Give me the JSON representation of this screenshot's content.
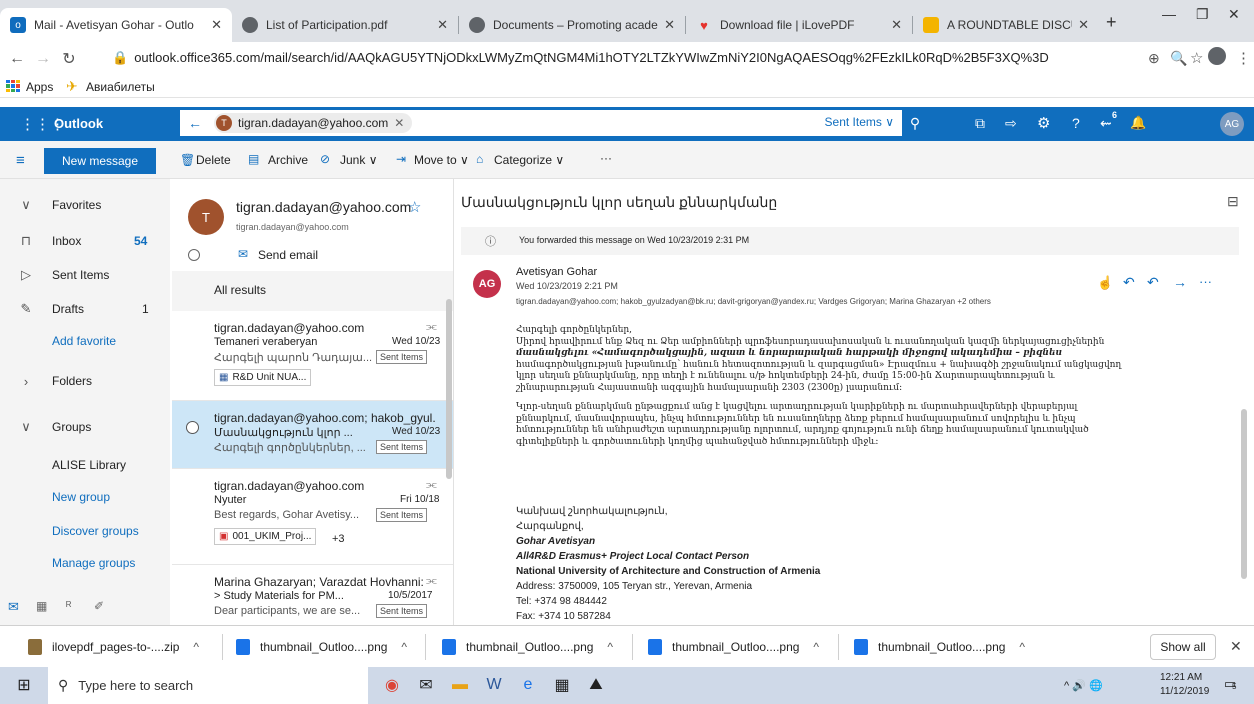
{
  "browser": {
    "tabs": [
      {
        "title": "Mail - Avetisyan Gohar - Outlo"
      },
      {
        "title": "List of Participation.pdf"
      },
      {
        "title": "Documents – Promoting acade"
      },
      {
        "title": "Download file | iLovePDF"
      },
      {
        "title": "A ROUNDTABLE DISCUSSION"
      }
    ],
    "new_tab": "+",
    "url": "outlook.office365.com/mail/search/id/AAQkAGU5YTNjODkxLWMyZmQtNGM4Mi1hOTY2LTZkYWIwZmNiY2I0NgAQAESOqg%2FEzkILk0RqD%2B5F3XQ%3D",
    "bookmarks": [
      "Apps",
      "Авиабилеты"
    ]
  },
  "outlook": {
    "app_name": "Outlook",
    "search_chip": "tigran.dadayan@yahoo.com",
    "search_scope": "Sent Items",
    "notif_count": "6",
    "avatar": "AG"
  },
  "commands": {
    "new_message": "New message",
    "delete": "Delete",
    "archive": "Archive",
    "junk": "Junk",
    "move_to": "Move to",
    "categorize": "Categorize",
    "more": "···"
  },
  "nav": {
    "favorites": "Favorites",
    "inbox": "Inbox",
    "inbox_count": "54",
    "sent": "Sent Items",
    "drafts": "Drafts",
    "drafts_count": "1",
    "add_favorite": "Add favorite",
    "folders": "Folders",
    "groups": "Groups",
    "alise": "ALISE Library",
    "new_group": "New group",
    "discover": "Discover groups",
    "manage": "Manage groups"
  },
  "contact": {
    "initial": "T",
    "name": "tigran.dadayan@yahoo.com",
    "email": "tigran.dadayan@yahoo.com",
    "send_email": "Send email",
    "all_results": "All results"
  },
  "messages": [
    {
      "from": "tigran.dadayan@yahoo.com",
      "subject": "Temaneri veraberyan",
      "date": "Wed 10/23",
      "preview": "Հարգելի պարոն Դադայա...",
      "folder": "Sent Items",
      "attachment": "R&D Unit NUA..."
    },
    {
      "from": "tigran.dadayan@yahoo.com; hakob_gyul.",
      "subject": "Մասնակցություն կլոր ...",
      "date": "Wed 10/23",
      "preview": "Հարգելի գործընկերներ, ...",
      "folder": "Sent Items"
    },
    {
      "from": "tigran.dadayan@yahoo.com",
      "subject": "Nyuter",
      "date": "Fri 10/18",
      "preview": "Best regards, Gohar Avetisy...",
      "folder": "Sent Items",
      "attachment": "001_UKIM_Proj...",
      "extra": "+3"
    },
    {
      "from": "Marina Ghazaryan; Varazdat Hovhanni:",
      "subject": "> Study Materials for PM...",
      "date": "10/5/2017",
      "preview": "Dear participants, we are se...",
      "folder": "Sent Items"
    }
  ],
  "reading": {
    "subject": "Մասնակցություն կլոր սեղան քննարկմանը",
    "forwarded_note": "You forwarded this message on Wed 10/23/2019 2:31 PM",
    "sender_initials": "AG",
    "sender": "Avetisyan Gohar",
    "sent_date": "Wed 10/23/2019 2:21 PM",
    "recipients": "tigran.dadayan@yahoo.com; hakob_gyulzadyan@bk.ru; davit-grigoryan@yandex.ru; Vardges Grigoryan; Marina Ghazaryan +2 others",
    "greeting": "Հարգելի գործընկերներ,",
    "p1_lines": [
      "Սիրով հրավիրում ենք Ձեզ ու Ձեր ամբիոնների պրոֆեսորադասախոսական և ուսանողական կազմի ներկայացուցիչներին",
      "մասնակցելու «Համագործակցային, ազատ և նորարարական հարթակի միջոցով ակադեմիա – բիզնես",
      "համագործակցության խթանումը՝ հանուն հետազոտության և զարգացման» Էրազմուս + նախագծի շրջանակում անցկացվող",
      "կլոր սեղան քննարկմանը, որը տեղի է ունենալու ս/թ հոկտեմբերի 24-ին, ժամը 15:00-ին Ճարտարապետության և",
      "շինարարության Հայաստանի ազգային համալսարանի 2303 (2300ը) լսարանում:"
    ],
    "p2_lines": [
      "Կլոր-սեղան քննարկման ընթացքում անց է կացվելու արտադրության կարիքների ու մարտահրավերների վերաբերյալ",
      "քննարկում, մասնավորապես, ինչպ հմտություններ են ուսանողները ձեռք բերում համալսարանում սովորելիս և ինչպ",
      "հմտություններ են անհրաժեշտ արտադրությանը ոլորտում, արդյոք գոյություն ունի ճեղք համալսարանում կուտակված",
      "գիտելիքների և գործատուների կողմից պահանջված հմտությունների միջև:"
    ],
    "closing": "Կանխավ շնորհակալություն,",
    "regards": "Հարգանքով,",
    "sig_name": "Gohar Avetisyan",
    "sig_title": "All4R&D Erasmus+ Project Local Contact Person",
    "sig_org": "National University of Architecture and Construction of Armenia",
    "sig_address": "Address: 3750009, 105 Teryan str., Yerevan, Armenia",
    "sig_tel": "Tel: +374 98 484442",
    "sig_fax": "Fax: +374 10 587284"
  },
  "downloads": {
    "items": [
      "ilovepdf_pages-to-....zip",
      "thumbnail_Outloo....png",
      "thumbnail_Outloo....png",
      "thumbnail_Outloo....png",
      "thumbnail_Outloo....png"
    ],
    "show_all": "Show all"
  },
  "taskbar": {
    "search_placeholder": "Type here to search",
    "time": "12:21 AM",
    "date": "11/12/2019",
    "notif": "5"
  },
  "colors": {
    "outlook_blue": "#106ebe",
    "selected_row": "#cde6f7",
    "avatar_brown": "#a0522d",
    "avatar_red": "#c4314b"
  }
}
